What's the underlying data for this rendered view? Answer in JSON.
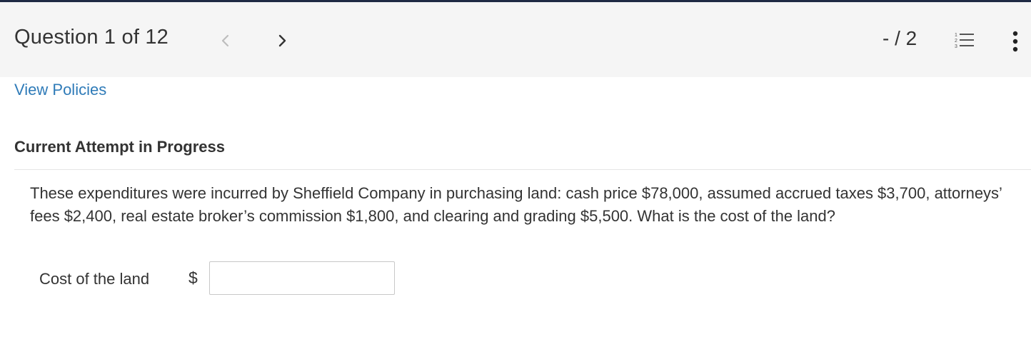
{
  "header": {
    "question_label": "Question 1 of 12",
    "score": "- / 2",
    "icons": {
      "prev": "chevron-left-icon",
      "next": "chevron-right-icon",
      "list": "numbered-list-icon",
      "more": "more-vertical-icon"
    }
  },
  "links": {
    "view_policies": "View Policies"
  },
  "section": {
    "attempt_heading": "Current Attempt in Progress"
  },
  "question": {
    "text": "These expenditures were incurred by Sheffield Company in purchasing land: cash price $78,000, assumed accrued taxes $3,700, attorneys’ fees $2,400, real estate broker’s commission $1,800, and clearing and grading $5,500. What is the cost of the land?"
  },
  "answer": {
    "label": "Cost of the land",
    "currency": "$",
    "value": "",
    "placeholder": ""
  },
  "colors": {
    "header_bg": "#f5f5f5",
    "top_border": "#1f2a44",
    "link": "#2f7bb8",
    "text": "#333333",
    "nav_prev_disabled": "#bdbdbd"
  }
}
